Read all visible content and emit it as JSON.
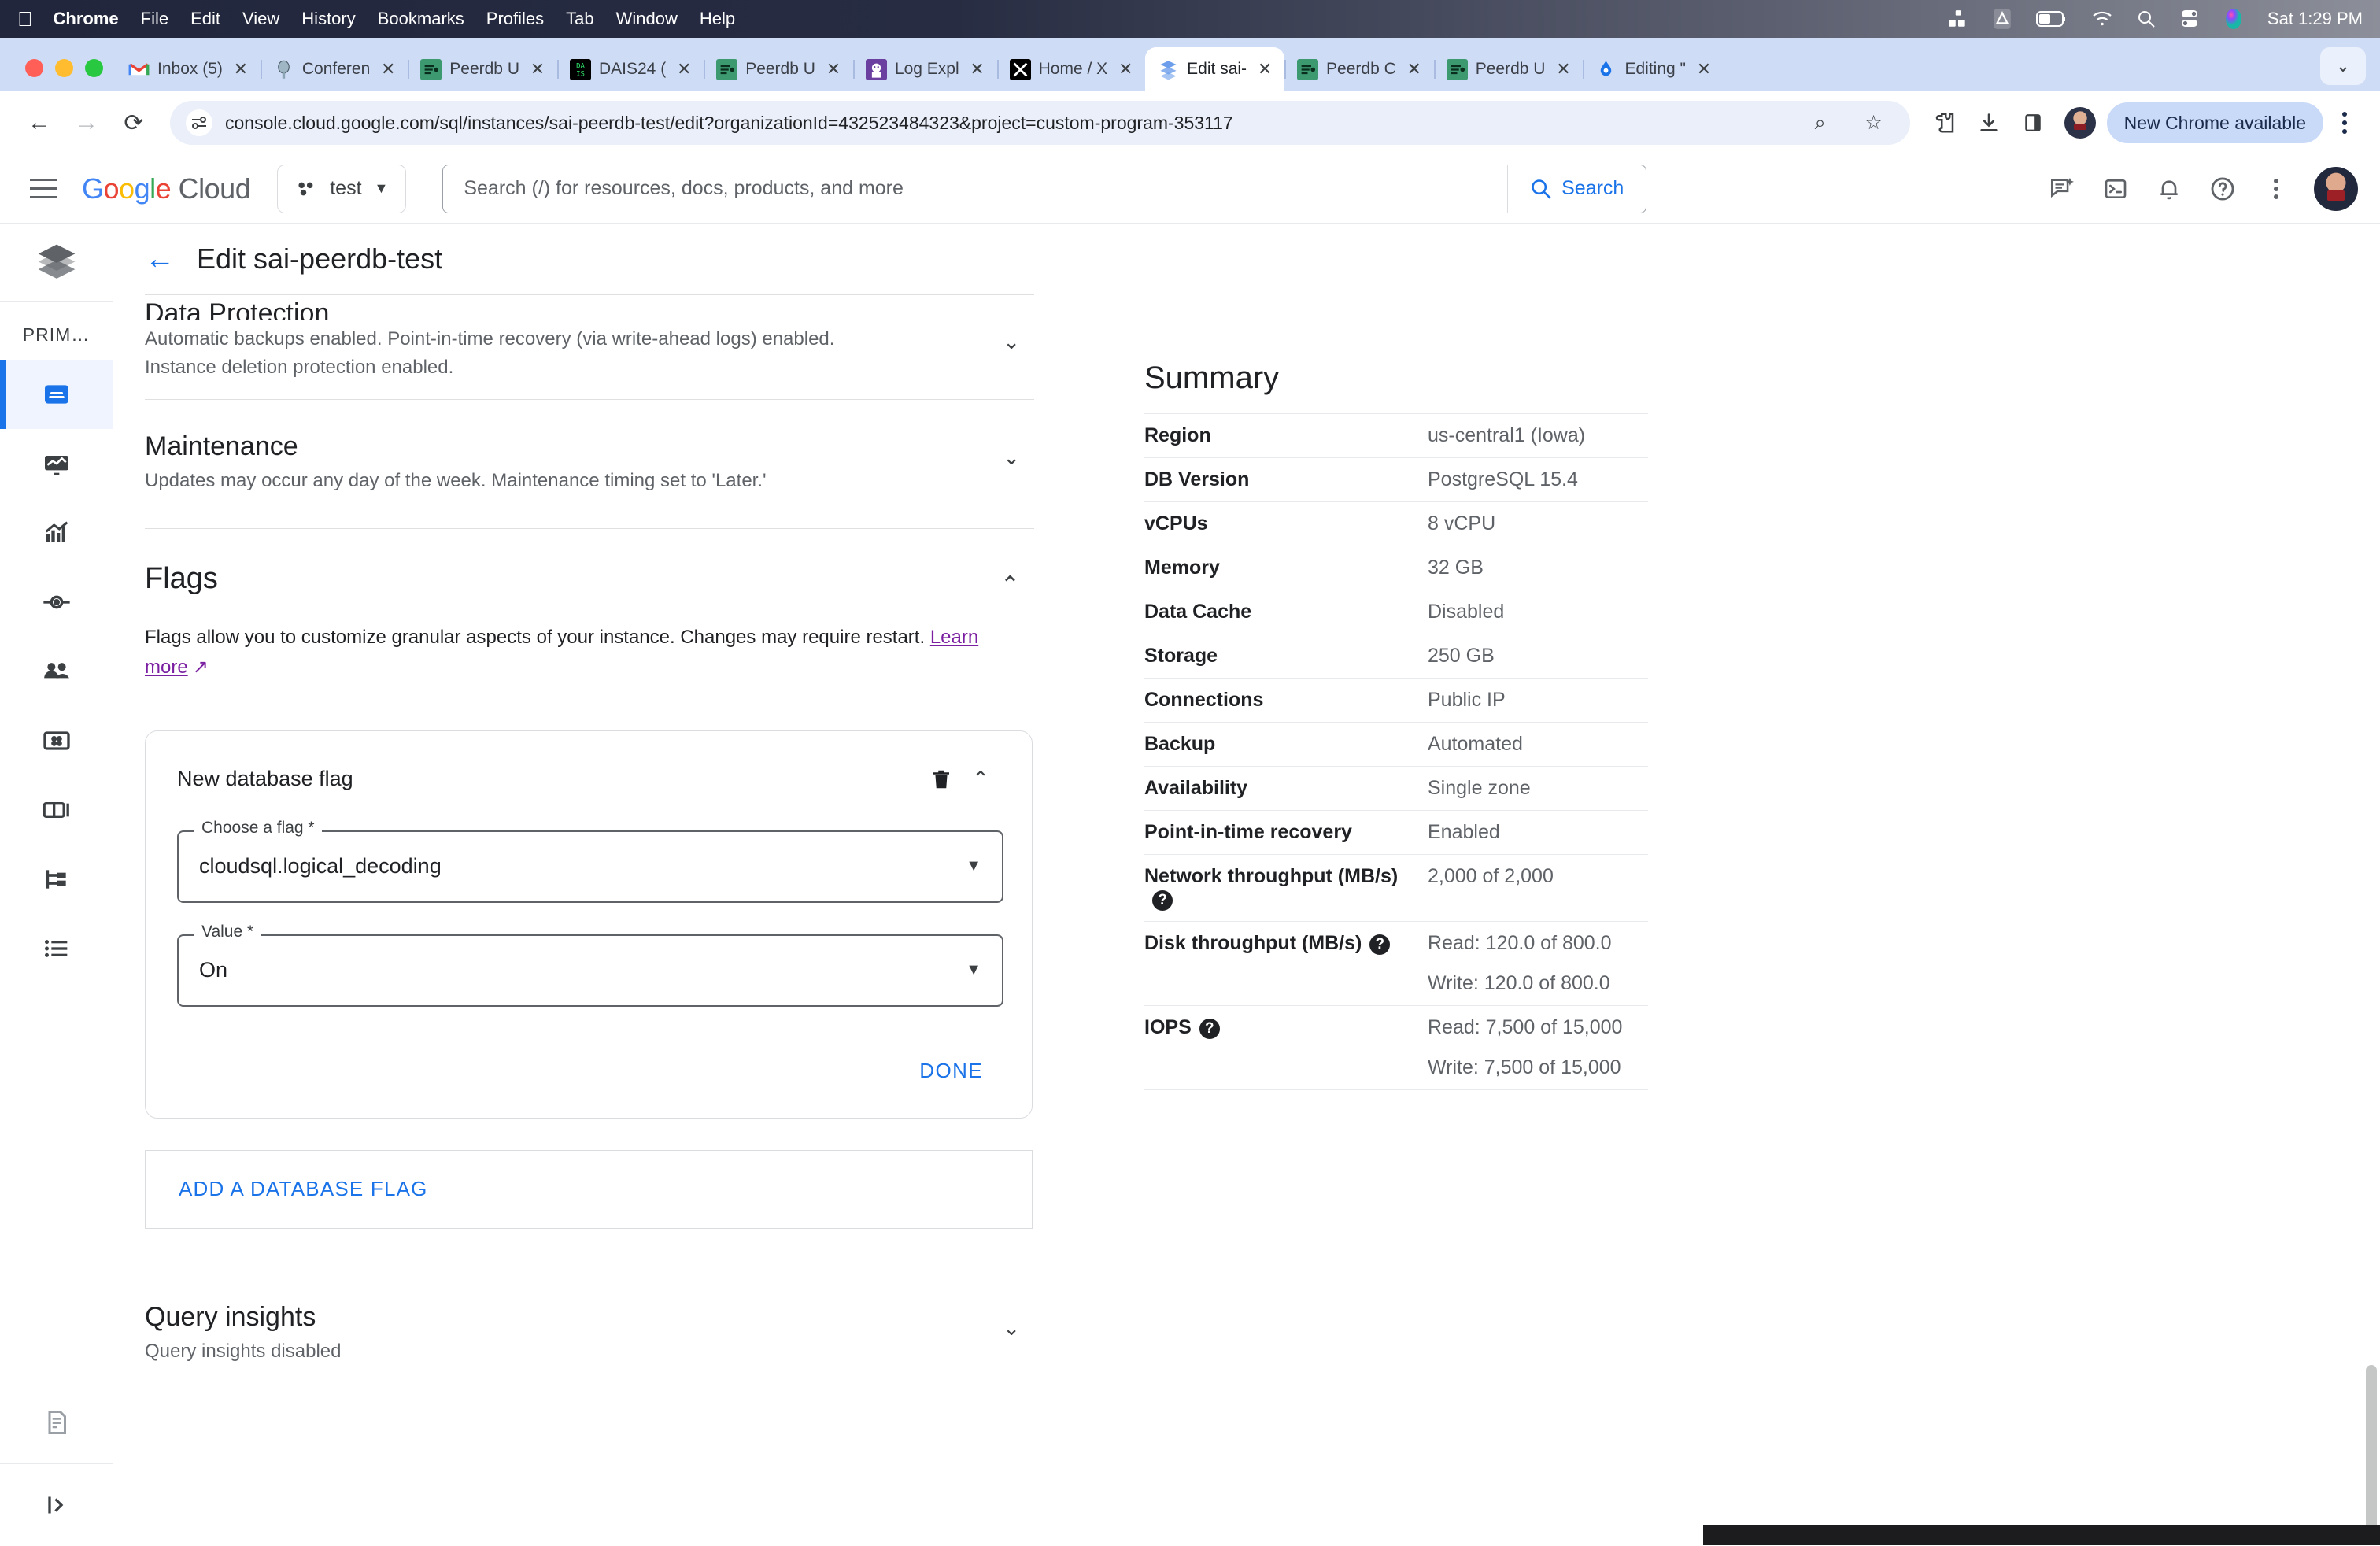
{
  "macos": {
    "apple_glyph": "",
    "menus": [
      "Chrome",
      "File",
      "Edit",
      "View",
      "History",
      "Bookmarks",
      "Profiles",
      "Tab",
      "Window",
      "Help"
    ],
    "status_icons": [
      "grid-icon",
      "drive-icon",
      "battery-icon",
      "wifi-icon",
      "spotlight-search-icon",
      "control-center-icon",
      "siri-icon"
    ],
    "clock": "Sat 1:29 PM"
  },
  "chrome": {
    "tabs": [
      {
        "title": "Inbox (5)",
        "favicon": "gmail-icon",
        "active": false
      },
      {
        "title": "Conferen",
        "favicon": "conference-icon",
        "active": false
      },
      {
        "title": "Peerdb U",
        "favicon": "peerdb-icon",
        "active": false
      },
      {
        "title": "DAIS24 (",
        "favicon": "dais-icon",
        "active": false
      },
      {
        "title": "Peerdb U",
        "favicon": "peerdb-icon",
        "active": false
      },
      {
        "title": "Log Expl",
        "favicon": "logexplorer-icon",
        "active": false
      },
      {
        "title": "Home / X",
        "favicon": "x-icon",
        "active": false
      },
      {
        "title": "Edit sai-",
        "favicon": "cloudsql-icon",
        "active": true
      },
      {
        "title": "Peerdb C",
        "favicon": "peerdb-icon",
        "active": false
      },
      {
        "title": "Peerdb U",
        "favicon": "peerdb-icon",
        "active": false
      },
      {
        "title": "Editing \"",
        "favicon": "editing-icon",
        "active": false
      }
    ],
    "close_glyph": "✕",
    "new_tab_glyph": "+",
    "tab_list_chevron": "⌄",
    "back_glyph": "←",
    "forward_glyph": "→",
    "reload_glyph": "⟳",
    "url": "console.cloud.google.com/sql/instances/sai-peerdb-test/edit?organizationId=432523484323&project=custom-program-353117",
    "zoom_glyph": "⌕",
    "star_glyph": "☆",
    "extensions_glyph": "🧩",
    "download_glyph": "⤓",
    "sidepanel_glyph": "▯",
    "new_chrome_label": "New Chrome available"
  },
  "gcloud": {
    "logo_google": "Google",
    "logo_cloud": "Cloud",
    "project": "test",
    "project_caret": "▼",
    "search_placeholder": "Search (/) for resources, docs, products, and more",
    "search_button": "Search",
    "header_icons": [
      "gemini-chat-icon",
      "cloud-shell-icon",
      "notifications-bell-icon",
      "help-question-icon",
      "more-kebab-icon"
    ]
  },
  "rail": {
    "logo": "cloudsql-layers-icon",
    "title": "PRIM…",
    "items": [
      {
        "name": "overview",
        "icon": "overview-card-icon",
        "active": true
      },
      {
        "name": "monitoring",
        "icon": "monitoring-chart-icon",
        "active": false
      },
      {
        "name": "insights",
        "icon": "insights-bars-icon",
        "active": false
      },
      {
        "name": "connections",
        "icon": "connections-node-icon",
        "active": false
      },
      {
        "name": "users",
        "icon": "users-people-icon",
        "active": false
      },
      {
        "name": "databases",
        "icon": "databases-grid-icon",
        "active": false
      },
      {
        "name": "backups",
        "icon": "backups-panel-icon",
        "active": false
      },
      {
        "name": "replicas",
        "icon": "replicas-tree-icon",
        "active": false
      },
      {
        "name": "operations",
        "icon": "operations-list-icon",
        "active": false
      }
    ],
    "bottom_icon": "logs-document-icon",
    "collapse_icon": "expand-panel-icon"
  },
  "page": {
    "back_arrow": "←",
    "title": "Edit sai-peerdb-test"
  },
  "sections": {
    "data_protection": {
      "title": "Data Protection",
      "desc_line1": "Automatic backups enabled. Point-in-time recovery (via write-ahead logs) enabled.",
      "desc_line2": "Instance deletion protection enabled.",
      "chevron": "⌄"
    },
    "maintenance": {
      "title": "Maintenance",
      "desc": "Updates may occur any day of the week. Maintenance timing set to 'Later.'",
      "chevron": "⌄"
    },
    "flags": {
      "title": "Flags",
      "chevron": "⌃",
      "desc_part1": "Flags allow you to customize granular aspects of your instance. Changes may require restart. ",
      "learn_more": "Learn more",
      "external_link_glyph": "↗",
      "card": {
        "title": "New database flag",
        "delete_icon": "trash-delete-icon",
        "collapse_chevron": "⌃",
        "flag_field_label": "Choose a flag *",
        "flag_field_value": "cloudsql.logical_decoding",
        "value_field_label": "Value *",
        "value_field_value": "On",
        "caret": "▼",
        "done_label": "DONE"
      },
      "add_flag_label": "ADD A DATABASE FLAG"
    },
    "query_insights": {
      "title": "Query insights",
      "desc": "Query insights disabled",
      "chevron": "⌄"
    }
  },
  "summary": {
    "title": "Summary",
    "rows": [
      {
        "key": "Region",
        "values": [
          "us-central1 (Iowa)"
        ],
        "help": false
      },
      {
        "key": "DB Version",
        "values": [
          "PostgreSQL 15.4"
        ],
        "help": false
      },
      {
        "key": "vCPUs",
        "values": [
          "8 vCPU"
        ],
        "help": false
      },
      {
        "key": "Memory",
        "values": [
          "32 GB"
        ],
        "help": false
      },
      {
        "key": "Data Cache",
        "values": [
          "Disabled"
        ],
        "help": false
      },
      {
        "key": "Storage",
        "values": [
          "250 GB"
        ],
        "help": false
      },
      {
        "key": "Connections",
        "values": [
          "Public IP"
        ],
        "help": false
      },
      {
        "key": "Backup",
        "values": [
          "Automated"
        ],
        "help": false
      },
      {
        "key": "Availability",
        "values": [
          "Single zone"
        ],
        "help": false
      },
      {
        "key": "Point-in-time recovery",
        "values": [
          "Enabled"
        ],
        "help": false
      },
      {
        "key": "Network throughput (MB/s)",
        "values": [
          "2,000 of 2,000"
        ],
        "help": true
      },
      {
        "key": "Disk throughput (MB/s)",
        "values": [
          "Read: 120.0 of 800.0",
          "Write: 120.0 of 800.0"
        ],
        "help": true
      },
      {
        "key": "IOPS",
        "values": [
          "Read: 7,500 of 15,000",
          "Write: 7,500 of 15,000"
        ],
        "help": true
      }
    ],
    "help_glyph": "?"
  },
  "colors": {
    "accent_blue": "#1a73e8",
    "link_purple": "#7b1fa2",
    "menubar": "#21263c",
    "tabstrip": "#cfdcf6"
  }
}
